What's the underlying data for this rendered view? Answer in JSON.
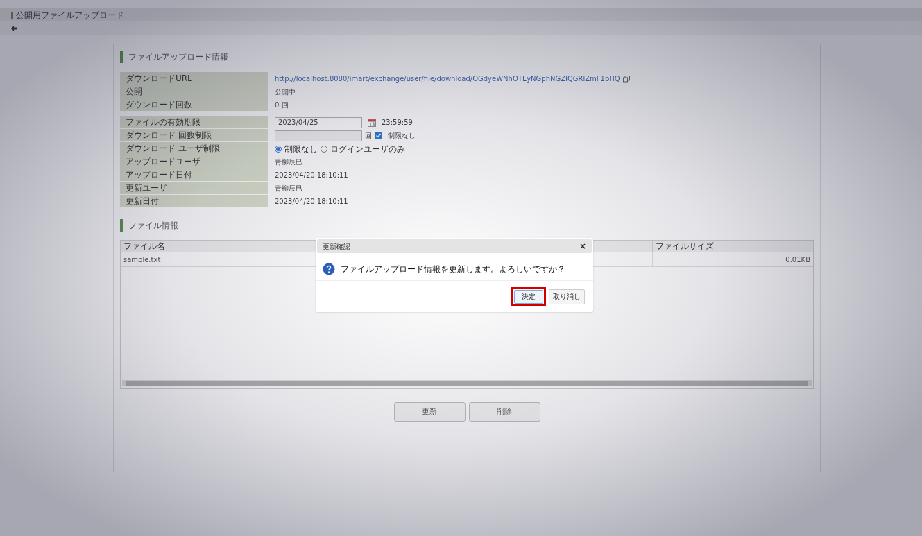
{
  "app_title": "公開用ファイルアップロード",
  "info": {
    "title": "ファイルアップロード情報",
    "group1": [
      {
        "kind": "link",
        "label": "ダウンロードURL",
        "value": "http://localhost:8080/imart/exchange/user/file/download/OGdyeWNhOTEyNGphNGZlQGRlZmF1bHQ"
      },
      {
        "kind": "text",
        "label": "公開",
        "value": "公開中"
      },
      {
        "kind": "text",
        "label": "ダウンロード回数",
        "value": "0 回"
      }
    ],
    "group2": [
      {
        "kind": "date",
        "label": "ファイルの有効期限",
        "value": "2023/04/25",
        "time": "23:59:59"
      },
      {
        "kind": "count",
        "label": "ダウンロード 回数制限",
        "unit": "回",
        "checkbox_label": "制限なし",
        "checked": true
      },
      {
        "kind": "radio",
        "label": "ダウンロード ユーザ制限",
        "options": [
          {
            "label": "制限なし",
            "selected": true
          },
          {
            "label": "ログインユーザのみ",
            "selected": false
          }
        ]
      },
      {
        "kind": "text",
        "label": "アップロードユーザ",
        "value": "青柳辰巳"
      },
      {
        "kind": "text",
        "label": "アップロード日付",
        "value": "2023/04/20 18:10:11"
      },
      {
        "kind": "text",
        "label": "更新ユーザ",
        "value": "青柳辰巳"
      },
      {
        "kind": "text",
        "label": "更新日付",
        "value": "2023/04/20 18:10:11"
      }
    ]
  },
  "files": {
    "title": "ファイル情報",
    "columns": [
      "ファイル名",
      "ファイルサイズ"
    ],
    "rows": [
      [
        "sample.txt",
        "0.01KB"
      ]
    ]
  },
  "buttons": [
    "更新",
    "削除"
  ],
  "dialog": {
    "title": "更新確認",
    "close": "×",
    "message": "ファイルアップロード情報を更新します。よろしいですか？",
    "buttons": [
      {
        "label": "決定",
        "highlighted": true
      },
      {
        "label": "取り消し",
        "highlighted": false
      }
    ]
  }
}
